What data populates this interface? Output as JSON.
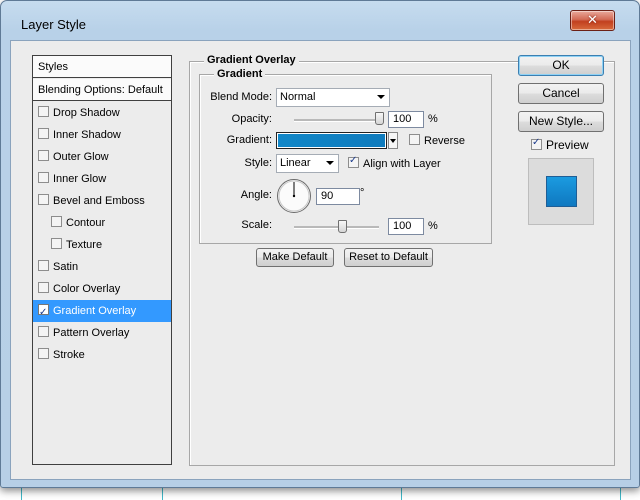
{
  "window": {
    "title": "Layer Style",
    "close_glyph": "✕"
  },
  "left_panel": {
    "header": "Styles",
    "blending": "Blending Options: Default",
    "items": [
      {
        "label": "Drop Shadow",
        "checked": false,
        "indent": false
      },
      {
        "label": "Inner Shadow",
        "checked": false,
        "indent": false
      },
      {
        "label": "Outer Glow",
        "checked": false,
        "indent": false
      },
      {
        "label": "Inner Glow",
        "checked": false,
        "indent": false
      },
      {
        "label": "Bevel and Emboss",
        "checked": false,
        "indent": false
      },
      {
        "label": "Contour",
        "checked": false,
        "indent": true
      },
      {
        "label": "Texture",
        "checked": false,
        "indent": true
      },
      {
        "label": "Satin",
        "checked": false,
        "indent": false
      },
      {
        "label": "Color Overlay",
        "checked": false,
        "indent": false
      },
      {
        "label": "Gradient Overlay",
        "checked": true,
        "indent": false,
        "selected": true
      },
      {
        "label": "Pattern Overlay",
        "checked": false,
        "indent": false
      },
      {
        "label": "Stroke",
        "checked": false,
        "indent": false
      }
    ]
  },
  "gradient_overlay": {
    "section_title": "Gradient Overlay",
    "group_title": "Gradient",
    "blend_mode_label": "Blend Mode:",
    "blend_mode_value": "Normal",
    "opacity_label": "Opacity:",
    "opacity_value": "100",
    "opacity_unit": "%",
    "gradient_label": "Gradient:",
    "reverse_label": "Reverse",
    "reverse_checked": false,
    "style_label": "Style:",
    "style_value": "Linear",
    "align_label": "Align with Layer",
    "align_checked": true,
    "angle_label": "Angle:",
    "angle_value": "90",
    "angle_unit": "°",
    "scale_label": "Scale:",
    "scale_value": "100",
    "scale_unit": "%",
    "make_default_label": "Make Default",
    "reset_default_label": "Reset to Default"
  },
  "actions": {
    "ok_label": "OK",
    "cancel_label": "Cancel",
    "new_style_label": "New Style...",
    "preview_label": "Preview",
    "preview_checked": true
  },
  "colors": {
    "selection": "#3399ff",
    "gradient_start": "#1187c8",
    "gradient_end": "#0f7bbd"
  }
}
